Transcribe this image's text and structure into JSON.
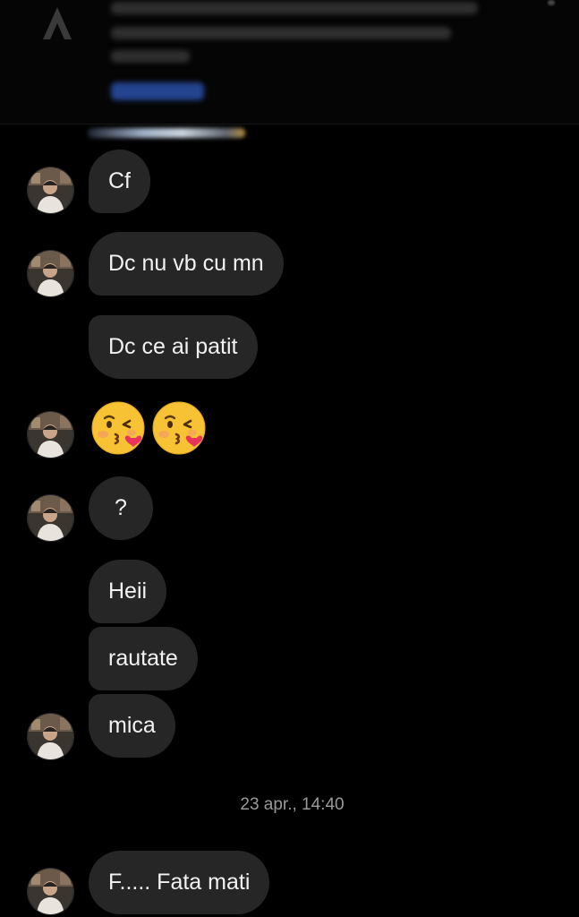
{
  "messages": {
    "m1": "Cf",
    "m2": "Dc nu vb cu mn",
    "m3": "Dc ce ai patit",
    "m4_emojis": [
      "kissing-face-with-heart",
      "kissing-face-with-heart"
    ],
    "m5": "?",
    "m6": "Heii",
    "m7": "rautate",
    "m8": "mica",
    "m9": "F..... Fata mati"
  },
  "timestamp": "23 apr., 14:40",
  "colors": {
    "background": "#000000",
    "bubble": "#262626",
    "text": "#f2f2f2",
    "timestamp": "#9a9a9a"
  }
}
